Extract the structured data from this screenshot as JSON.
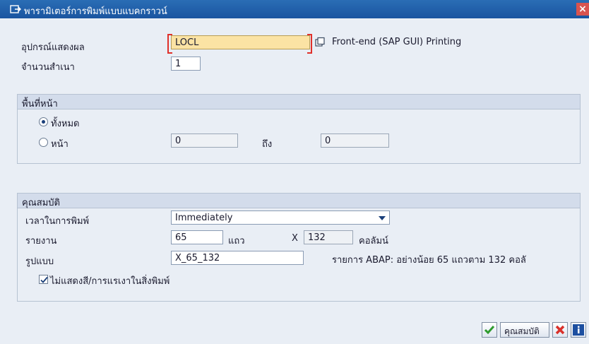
{
  "window": {
    "title": "พารามิเตอร์การพิมพ์แบบแบคกราวน์",
    "close_label": "×"
  },
  "output": {
    "device_label": "อุปกรณ์แสดงผล",
    "device_value": "LOCL",
    "device_description": "Front-end (SAP GUI) Printing",
    "copies_label": "จำนวนสำเนา",
    "copies_value": "1"
  },
  "page_area": {
    "header": "พื้นที่หน้า",
    "all_label": "ทั้งหมด",
    "page_label": "หน้า",
    "from_value": "0",
    "to_label": "ถึง",
    "to_value": "0",
    "selected": "all"
  },
  "properties": {
    "header": "คุณสมบัติ",
    "print_time_label": "เวลาในการพิมพ์",
    "print_time_value": "Immediately",
    "report_label": "รายงาน",
    "rows_value": "65",
    "rows_unit": "แถว",
    "times_symbol": "X",
    "cols_value": "132",
    "cols_unit": "คอลัมน์",
    "format_label": "รูปแบบ",
    "format_value": "X_65_132",
    "format_description": "รายการ ABAP: อย่างน้อย 65 แถวตาม 132 คอลั",
    "no_color_label": "ไม่แสดงสี/การแรเงาในสิ่งพิมพ์",
    "no_color_checked": true
  },
  "footer": {
    "confirm_icon": "check-icon",
    "properties_button": "คุณสมบัติ",
    "cancel_icon": "cancel-icon",
    "info_icon": "info-icon",
    "colors": {
      "confirm": "#2e9b2e",
      "cancel": "#d9302a",
      "info": "#1d4fa0"
    }
  }
}
